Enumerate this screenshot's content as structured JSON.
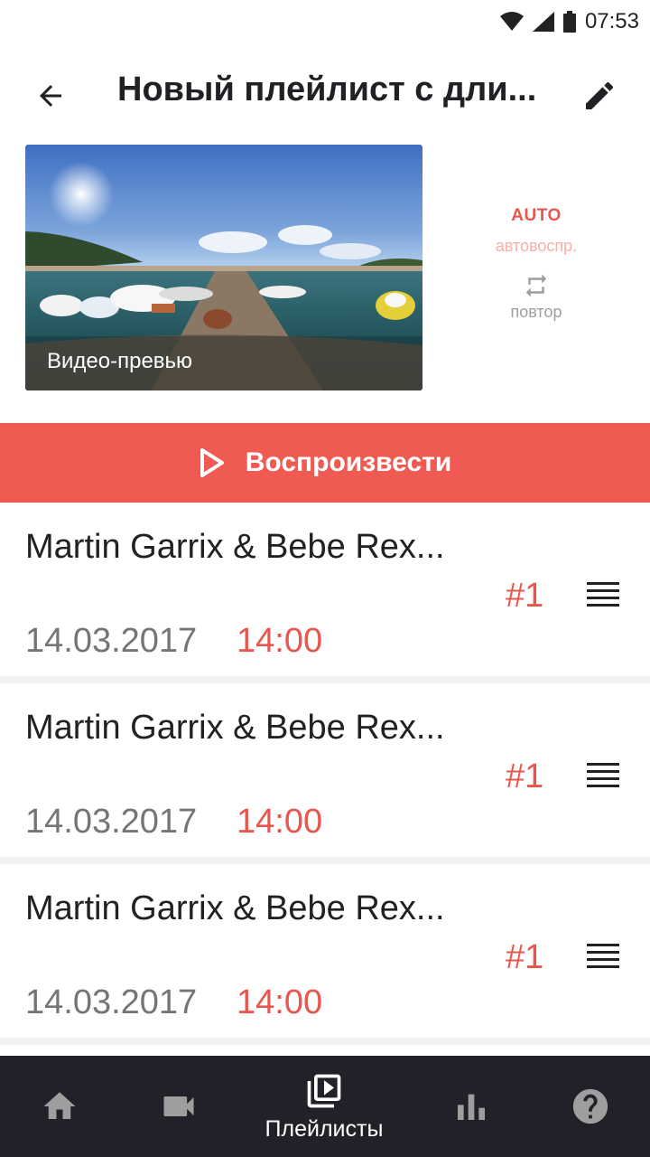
{
  "status_bar": {
    "time": "07:53",
    "icons": [
      "wifi-icon",
      "signal-icon",
      "battery-icon"
    ]
  },
  "header": {
    "title": "Новый плейлист с дли...",
    "back_icon": "arrow-back-icon",
    "edit_icon": "pencil-icon"
  },
  "preview": {
    "label": "Видео-превью"
  },
  "controls": {
    "auto_label": "AUTO",
    "auto_sub": "автовоспр.",
    "repeat_label": "повтор",
    "repeat_icon": "repeat-icon"
  },
  "play": {
    "label": "Воспроизвести",
    "icon": "play-outline-icon"
  },
  "items": [
    {
      "title": "Martin Garrix & Bebe Rex...",
      "number": "#1",
      "date": "14.03.2017",
      "time": "14:00"
    },
    {
      "title": "Martin Garrix & Bebe Rex...",
      "number": "#1",
      "date": "14.03.2017",
      "time": "14:00"
    },
    {
      "title": "Martin Garrix & Bebe Rex...",
      "number": "#1",
      "date": "14.03.2017",
      "time": "14:00"
    }
  ],
  "bottom_nav": {
    "items": [
      {
        "icon": "home-icon",
        "label": ""
      },
      {
        "icon": "videocam-icon",
        "label": ""
      },
      {
        "icon": "playlist-play-icon",
        "label": "Плейлисты",
        "active": true
      },
      {
        "icon": "bar-chart-icon",
        "label": ""
      },
      {
        "icon": "help-icon",
        "label": ""
      }
    ]
  },
  "colors": {
    "accent": "#ef5b52",
    "accent_text": "#e8564d",
    "nav_bg": "#222129",
    "inactive_icon": "#9e9e9e"
  }
}
